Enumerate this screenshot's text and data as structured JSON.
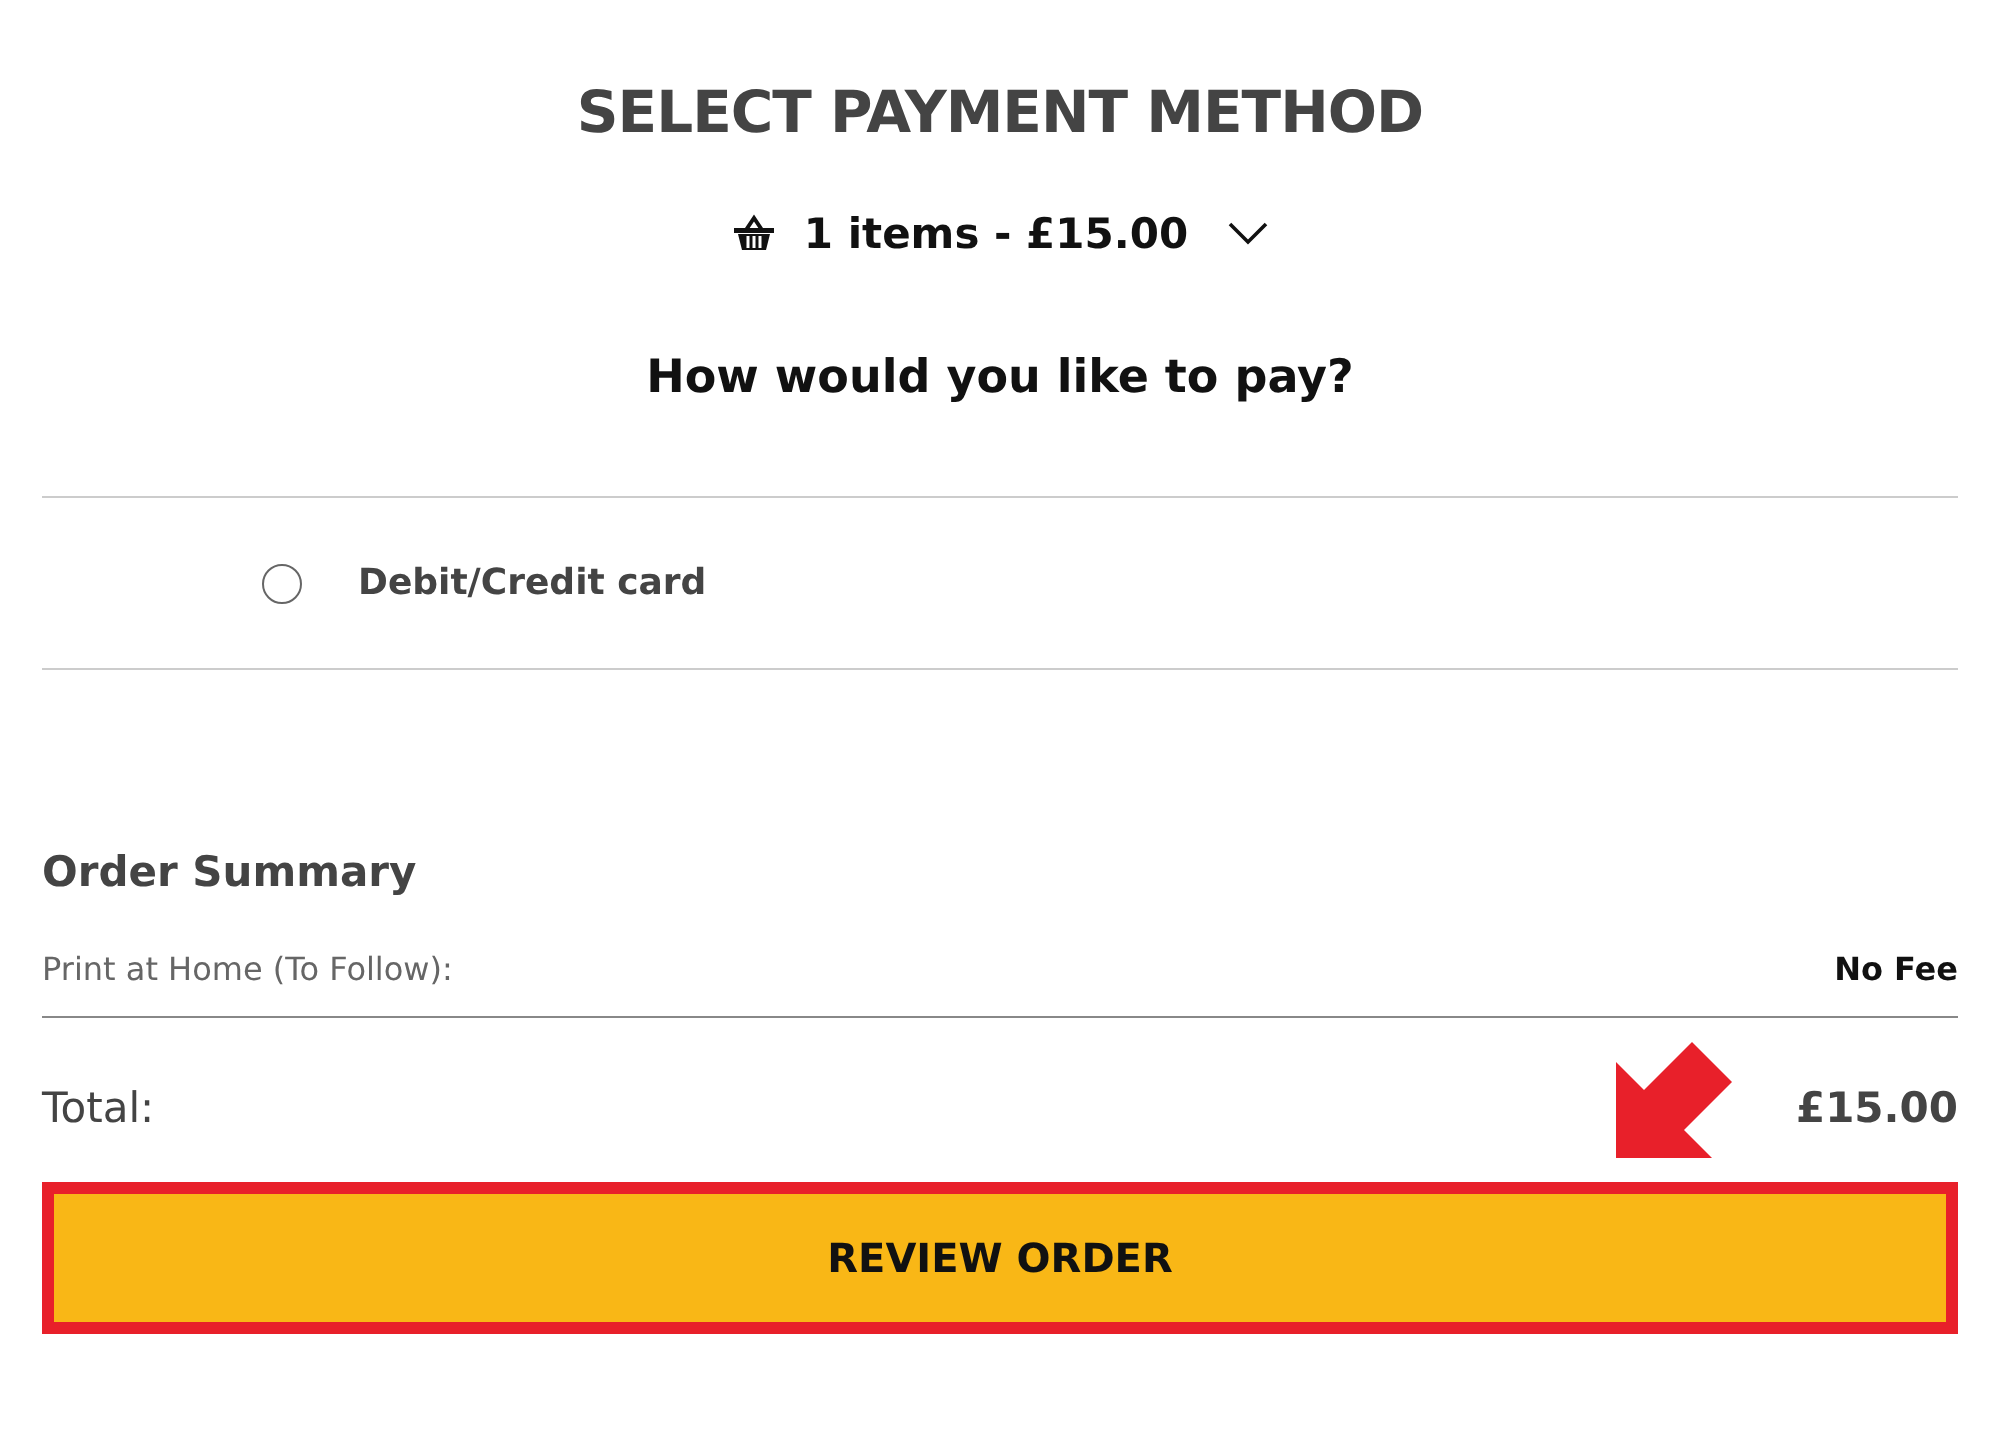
{
  "title": "SELECT PAYMENT METHOD",
  "basket": {
    "summary": "1 items - £15.00",
    "expanded": false
  },
  "question": "How would you like to pay?",
  "payment_options": [
    {
      "label": "Debit/Credit card",
      "selected": false
    }
  ],
  "order_summary": {
    "heading": "Order Summary",
    "lines": [
      {
        "label": "Print at Home (To Follow):",
        "value": "No Fee"
      }
    ],
    "total_label": "Total:",
    "total_value": "£15.00"
  },
  "review_button": {
    "label": "REVIEW ORDER",
    "highlighted": true
  }
}
